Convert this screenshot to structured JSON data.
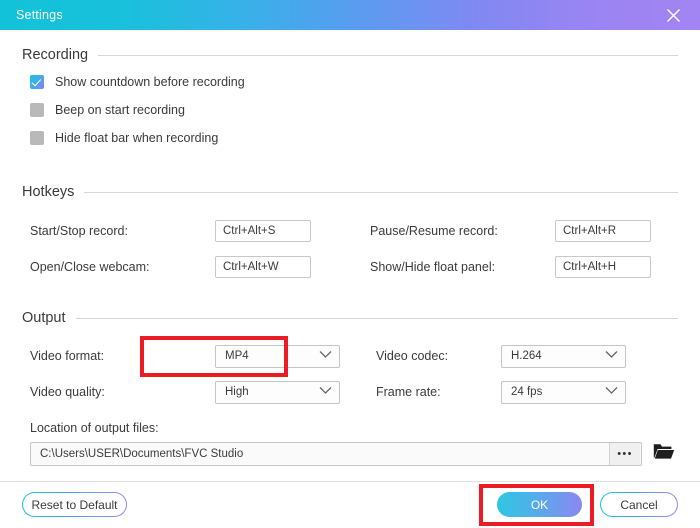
{
  "window": {
    "title": "Settings",
    "close_icon": "close-icon"
  },
  "theme": {
    "gradient_start": "#12c2d8",
    "gradient_end": "#a285f2",
    "accent_cyan": "#19c6de",
    "accent_purple": "#9a85f3",
    "annotation_red": "#ec1c24"
  },
  "sections": {
    "recording": {
      "title": "Recording",
      "options": [
        {
          "label": "Show countdown before recording",
          "checked": true
        },
        {
          "label": "Beep on start recording",
          "checked": false
        },
        {
          "label": "Hide float bar when recording",
          "checked": false
        }
      ]
    },
    "hotkeys": {
      "title": "Hotkeys",
      "rows": [
        {
          "left_label": "Start/Stop record:",
          "left_value": "Ctrl+Alt+S",
          "right_label": "Pause/Resume record:",
          "right_value": "Ctrl+Alt+R"
        },
        {
          "left_label": "Open/Close webcam:",
          "left_value": "Ctrl+Alt+W",
          "right_label": "Show/Hide float panel:",
          "right_value": "Ctrl+Alt+H"
        }
      ]
    },
    "output": {
      "title": "Output",
      "rows": [
        {
          "left_label": "Video format:",
          "left_value": "MP4",
          "right_label": "Video codec:",
          "right_value": "H.264"
        },
        {
          "left_label": "Video quality:",
          "left_value": "High",
          "right_label": "Frame rate:",
          "right_value": "24 fps"
        }
      ],
      "location_label": "Location of output files:",
      "location_value": "C:\\Users\\USER\\Documents\\FVC Studio",
      "browse_label": "•••",
      "folder_icon": "folder-icon"
    }
  },
  "footer": {
    "reset_label": "Reset to Default",
    "ok_label": "OK",
    "cancel_label": "Cancel"
  },
  "annotations": [
    {
      "name": "video-format-highlight",
      "target": "Video format dropdown"
    },
    {
      "name": "ok-button-highlight",
      "target": "OK button"
    }
  ]
}
